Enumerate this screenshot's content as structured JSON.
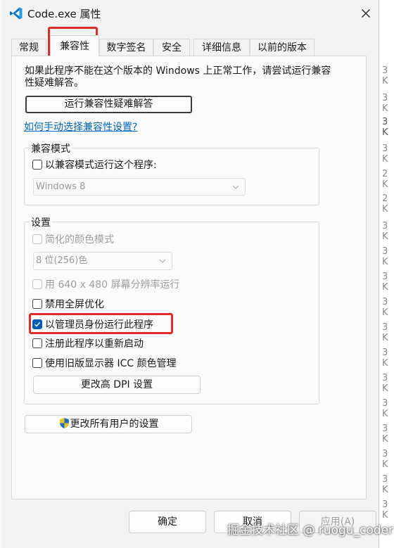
{
  "window": {
    "title": "Code.exe 属性"
  },
  "tabs": [
    {
      "label": "常规"
    },
    {
      "label": "兼容性"
    },
    {
      "label": "数字签名"
    },
    {
      "label": "安全"
    },
    {
      "label": "详细信息"
    },
    {
      "label": "以前的版本"
    }
  ],
  "compat": {
    "description": "如果此程序不能在这个版本的 Windows 上正常工作，请尝试运行兼容性疑难解答。",
    "troubleshooter_button": "运行兼容性疑难解答",
    "manual_link": "如何手动选择兼容性设置?",
    "mode_group_title": "兼容模式",
    "mode_checkbox_label": "以兼容模式运行这个程序:",
    "mode_select_value": "Windows 8"
  },
  "settings": {
    "group_title": "设置",
    "reduced_color_label": "简化的颜色模式",
    "color_select_value": "8 位(256)色",
    "res_640_label": "用 640 x 480 屏幕分辨率运行",
    "fullscreen_opt_label": "禁用全屏优化",
    "run_as_admin_label": "以管理员身份运行此程序",
    "register_restart_label": "注册此程序以重新启动",
    "legacy_icc_label": "使用旧版显示器 ICC 颜色管理",
    "high_dpi_button": "更改高 DPI 设置",
    "all_users_button": "更改所有用户的设置"
  },
  "checkbox_states": {
    "compat_mode": false,
    "reduced_color": false,
    "res_640": false,
    "disable_fullscreen_opt": false,
    "run_as_admin": true,
    "register_restart": false,
    "legacy_icc": false
  },
  "footer": {
    "ok": "确定",
    "cancel": "取消",
    "apply": "应用(A)"
  },
  "background_list": {
    "size_suffix": [
      "3 K",
      "3 K",
      "3 K",
      "3 K",
      "2 K",
      "2 K",
      "3 K",
      "3 K",
      "3 K",
      "3 K",
      "3 K",
      "3 K",
      "3 K",
      "3 K",
      "3 K",
      "3 K",
      "3 K",
      "3 K",
      "3 K",
      "3 K",
      "3 K",
      "3 K"
    ]
  },
  "watermark": "掘金技术社区 @ ruogu_coder",
  "colors": {
    "accent": "#005fb8",
    "link": "#0067c0",
    "highlight_box": "#e22b2b"
  }
}
